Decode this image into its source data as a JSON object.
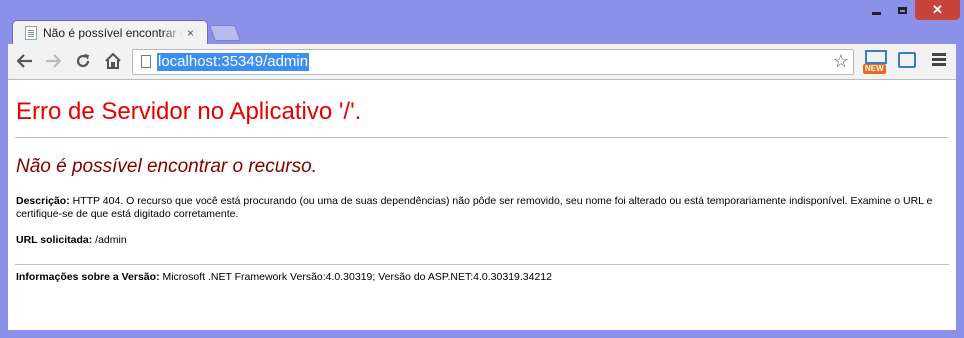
{
  "window": {
    "controls": {
      "minimize": "",
      "maximize": "",
      "close": "✕"
    }
  },
  "tab": {
    "title": "Não é possível encontrar o recurso.",
    "close": "×"
  },
  "toolbar": {
    "url": "localhost:35349/admin",
    "extension_badge": "NEW"
  },
  "page": {
    "heading": "Erro de Servidor no Aplicativo '/'.",
    "subheading": "Não é possível encontrar o recurso.",
    "description_label": "Descrição:",
    "description_text": " HTTP 404. O recurso que você está procurando (ou uma de suas dependências) não pôde ser removido, seu nome foi alterado ou está temporariamente indisponível. Examine o URL e certifique-se de que está digitado corretamente.",
    "requested_url_label": "URL solicitada:",
    "requested_url_value": " /admin",
    "version_label": "Informações sobre a Versão:",
    "version_value": " Microsoft .NET Framework Versão:4.0.30319; Versão do ASP.NET:4.0.30319.34212"
  },
  "colors": {
    "frame": "#8b90e8",
    "heading": "#e60000",
    "subheading": "#800000",
    "url_highlight": "#3a8ff0"
  }
}
